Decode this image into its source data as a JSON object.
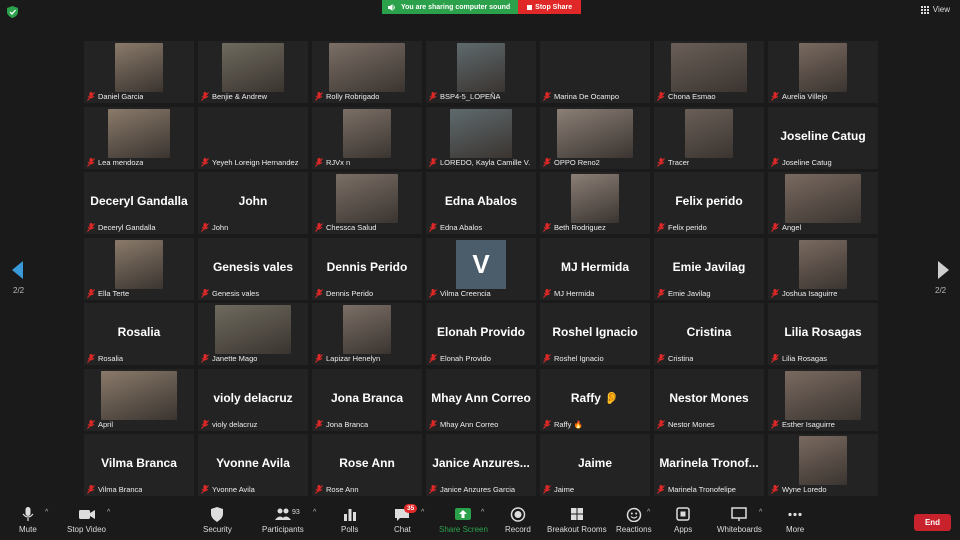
{
  "colors": {
    "share_green": "#2ca14b",
    "stop_red": "#e02828",
    "end_red": "#c8232c",
    "tile_bg": "#232323",
    "avatar_v": "#4b5d6a",
    "nav_blue": "#3a9ad9"
  },
  "topbar": {
    "sharing_message": "You are sharing computer sound",
    "stop_share_label": "Stop Share",
    "view_label": "View"
  },
  "pager": {
    "left": "2/2",
    "right": "2/2"
  },
  "tiles": [
    {
      "label": "Daniel Garcia",
      "photo": true
    },
    {
      "label": "Benjie & Andrew",
      "photo": true
    },
    {
      "label": "Rolly Robrigado",
      "photo": true
    },
    {
      "label": "BSP4-5_LOPEÑA",
      "photo": true
    },
    {
      "label": "Marina De Ocampo"
    },
    {
      "label": "Chona Esmao",
      "photo": true
    },
    {
      "label": "Aurelia Villejo",
      "photo": true
    },
    {
      "label": "Lea mendoza",
      "photo": true
    },
    {
      "label": "Yeyeh Loreign Hernandez"
    },
    {
      "label": "RJVx n",
      "photo": true
    },
    {
      "label": "LOREDO, Kayla Camille V.",
      "photo": true
    },
    {
      "label": "OPPO Reno2",
      "photo": true
    },
    {
      "label": "Tracer",
      "photo": true
    },
    {
      "big": "Joseline Catug",
      "label": "Joseline Catug"
    },
    {
      "big": "Deceryl  Gandalla",
      "label": "Deceryl  Gandalla"
    },
    {
      "big": "John",
      "label": "John"
    },
    {
      "label": "Chessca Salud",
      "photo": true
    },
    {
      "big": "Edna Abalos",
      "label": "Edna Abalos"
    },
    {
      "label": "Beth Rodriguez",
      "photo": true
    },
    {
      "big": "Felix perido",
      "label": "Felix perido"
    },
    {
      "label": "Angel",
      "photo": true
    },
    {
      "label": "Ella Terte",
      "photo": true
    },
    {
      "big": "Genesis vales",
      "label": "Genesis vales"
    },
    {
      "big": "Dennis Perido",
      "label": "Dennis Perido"
    },
    {
      "avatar": "V",
      "label": "Vilma Creencia"
    },
    {
      "big": "MJ Hermida",
      "label": "MJ Hermida"
    },
    {
      "big": "Emie Javilag",
      "label": "Emie Javilag"
    },
    {
      "label": "Joshua Isaguirre",
      "photo": true
    },
    {
      "big": "Rosalia",
      "label": "Rosalia"
    },
    {
      "label": "Janette Mago",
      "photo": true
    },
    {
      "label": "Lapizar Henelyn",
      "photo": true
    },
    {
      "big": "Elonah Provido",
      "label": "Elonah Provido"
    },
    {
      "big": "Roshel Ignacio",
      "label": "Roshel Ignacio"
    },
    {
      "big": "Cristina",
      "label": "Cristina"
    },
    {
      "big": "Lilia Rosagas",
      "label": "Lilia Rosagas"
    },
    {
      "label": "April",
      "photo": true
    },
    {
      "big": "violy delacruz",
      "label": "violy delacruz"
    },
    {
      "big": "Jona Branca",
      "label": "Jona Branca"
    },
    {
      "big": "Mhay Ann Correo",
      "label": "Mhay Ann Correo"
    },
    {
      "big": "Raffy 👂",
      "label": "Raffy 🔥"
    },
    {
      "big": "Nestor Mones",
      "label": "Nestor Mones"
    },
    {
      "label": "Esther Isaguirre",
      "photo": true
    },
    {
      "big": "Vilma Branca",
      "label": "Vilma Branca"
    },
    {
      "big": "Yvonne Avila",
      "label": "Yvonne Avila"
    },
    {
      "big": "Rose Ann",
      "label": "Rose Ann"
    },
    {
      "big": "Janice  Anzures...",
      "label": "Janice Anzures Garcia"
    },
    {
      "big": "Jaime",
      "label": "Jaime"
    },
    {
      "big": "Marinela  Tronof...",
      "label": "Marinela Tronofelipe"
    },
    {
      "label": "Wyne Loredo",
      "photo": true
    }
  ],
  "toolbar": {
    "mute": "Mute",
    "stop_video": "Stop Video",
    "security": "Security",
    "participants": "Participants",
    "participants_count": "93",
    "polls": "Polls",
    "chat": "Chat",
    "chat_badge": "35",
    "share_screen": "Share Screen",
    "record": "Record",
    "breakout_rooms": "Breakout Rooms",
    "reactions": "Reactions",
    "apps": "Apps",
    "whiteboards": "Whiteboards",
    "more": "More",
    "end": "End"
  }
}
